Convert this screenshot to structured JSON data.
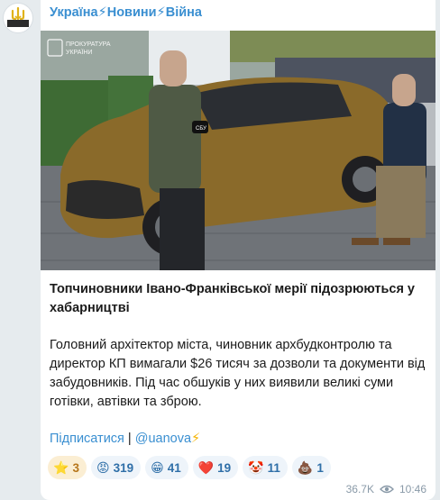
{
  "channel": {
    "title": "Україна⚡Новини⚡Війна"
  },
  "photo": {
    "watermark_line1": "ПРОКУРАТУРА",
    "watermark_line2": "УКРАЇНИ",
    "patch_text": "СБУ"
  },
  "post": {
    "title": "Топчиновники Івано-Франківської мерії підозрюються у хабарництві",
    "body": "Головний архітектор міста, чиновник архбудконтролю та директор КП вимагали $26 тисяч за дозволи та документи від забудовників. Під час обшуків у них виявили великі суми готівки, автівки та зброю."
  },
  "links": {
    "subscribe": "Підписатися",
    "separator": " | ",
    "handle": "@uanova",
    "bolt": "⚡"
  },
  "reactions": [
    {
      "emoji": "⭐",
      "count": "3",
      "paid": true
    },
    {
      "emoji": "😡",
      "count": "319"
    },
    {
      "emoji": "😁",
      "count": "41"
    },
    {
      "emoji": "❤️",
      "count": "19"
    },
    {
      "emoji": "🤡",
      "count": "11"
    },
    {
      "emoji": "💩",
      "count": "1"
    }
  ],
  "meta": {
    "views": "36.7K",
    "time": "10:46"
  }
}
